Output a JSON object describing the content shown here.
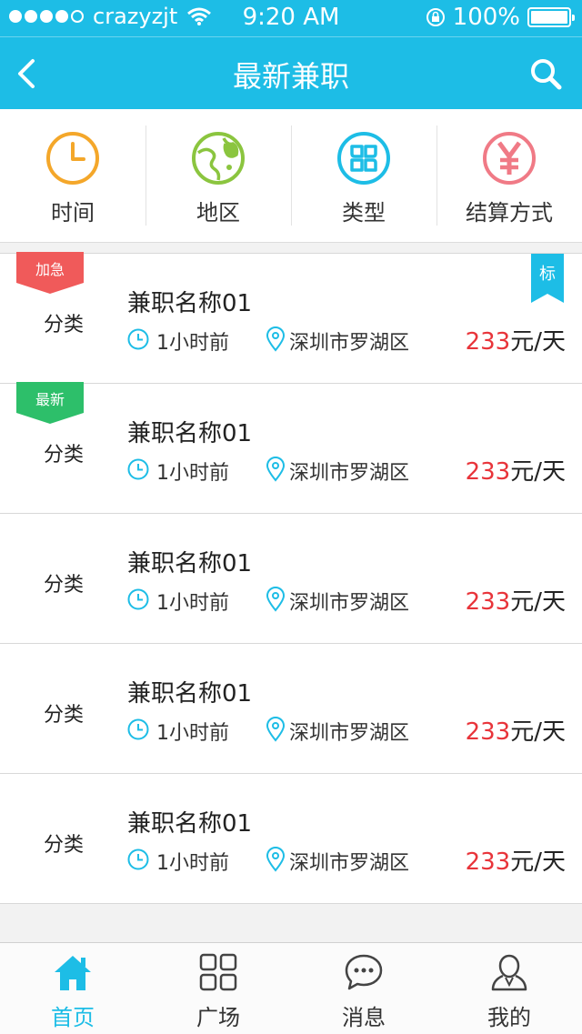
{
  "status_bar": {
    "carrier": "crazyzjt",
    "time": "9:20 AM",
    "battery": "100%"
  },
  "nav": {
    "title": "最新兼职",
    "back_icon": "chevron-left-icon",
    "search_icon": "search-icon"
  },
  "filters": [
    {
      "label": "时间",
      "icon": "clock-icon",
      "color": "#f4a72a"
    },
    {
      "label": "地区",
      "icon": "globe-icon",
      "color": "#8bc53f"
    },
    {
      "label": "类型",
      "icon": "category-icon",
      "color": "#1dbde6"
    },
    {
      "label": "结算方式",
      "icon": "yen-icon",
      "color": "#f07a86"
    }
  ],
  "jobs": [
    {
      "category": "分类",
      "name": "兼职名称01",
      "time": "1小时前",
      "location": "深圳市罗湖区",
      "price": "233",
      "unit": "元/天",
      "badge": "加急",
      "badge_color": "#f05a5a",
      "corner": "标"
    },
    {
      "category": "分类",
      "name": "兼职名称01",
      "time": "1小时前",
      "location": "深圳市罗湖区",
      "price": "233",
      "unit": "元/天",
      "badge": "最新",
      "badge_color": "#2dbf6a"
    },
    {
      "category": "分类",
      "name": "兼职名称01",
      "time": "1小时前",
      "location": "深圳市罗湖区",
      "price": "233",
      "unit": "元/天"
    },
    {
      "category": "分类",
      "name": "兼职名称01",
      "time": "1小时前",
      "location": "深圳市罗湖区",
      "price": "233",
      "unit": "元/天"
    },
    {
      "category": "分类",
      "name": "兼职名称01",
      "time": "1小时前",
      "location": "深圳市罗湖区",
      "price": "233",
      "unit": "元/天"
    }
  ],
  "tabs": [
    {
      "label": "首页",
      "icon": "home-icon",
      "active": true
    },
    {
      "label": "广场",
      "icon": "grid-icon",
      "active": false
    },
    {
      "label": "消息",
      "icon": "message-icon",
      "active": false
    },
    {
      "label": "我的",
      "icon": "user-icon",
      "active": false
    }
  ],
  "colors": {
    "primary": "#1dbde6",
    "price": "#e8343a"
  }
}
